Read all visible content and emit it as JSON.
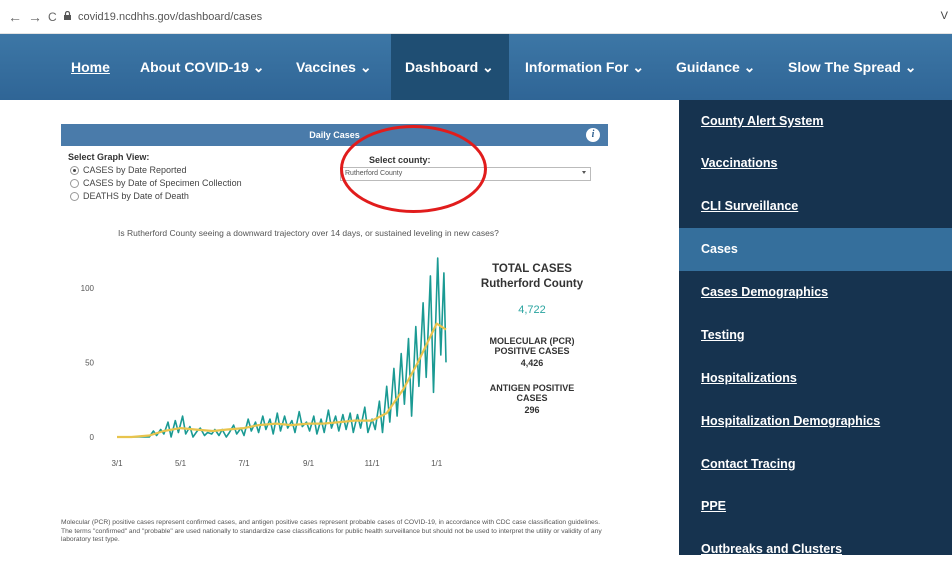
{
  "browser": {
    "back": "←",
    "forward": "→",
    "reload": "C",
    "url": "covid19.ncdhhs.gov/dashboard/cases",
    "edge_char": "V"
  },
  "nav": {
    "home": "Home",
    "about": "About COVID-19 ⌄",
    "vaccines": "Vaccines ⌄",
    "dashboard": "Dashboard ⌄",
    "information": "Information For ⌄",
    "guidance": "Guidance ⌄",
    "slow": "Slow The Spread ⌄"
  },
  "sidebar": {
    "items": [
      {
        "label": "County Alert System",
        "active": false
      },
      {
        "label": "Vaccinations",
        "active": false
      },
      {
        "label": "CLI Surveillance",
        "active": false
      },
      {
        "label": "Cases",
        "active": true
      },
      {
        "label": "Cases Demographics",
        "active": false
      },
      {
        "label": "Testing",
        "active": false
      },
      {
        "label": "Hospitalizations",
        "active": false
      },
      {
        "label": "Hospitalization Demographics",
        "active": false
      },
      {
        "label": "Contact Tracing",
        "active": false
      },
      {
        "label": "PPE",
        "active": false
      },
      {
        "label": "Outbreaks and Clusters",
        "active": false
      }
    ]
  },
  "panel": {
    "title": "Daily Cases",
    "info": "i",
    "graph_view_title": "Select Graph View:",
    "options": [
      {
        "label": "CASES by Date Reported",
        "checked": true
      },
      {
        "label": "CASES by Date of Specimen Collection",
        "checked": false
      },
      {
        "label": "DEATHS by Date of Death",
        "checked": false
      }
    ],
    "county_label": "Select county:",
    "county_value": "Rutherford County",
    "question": "Is Rutherford County seeing a downward trajectory over 14 days, or sustained leveling in new cases?"
  },
  "stats": {
    "total_title": "TOTAL CASES",
    "total_county": "Rutherford County",
    "total_value": "4,722",
    "pcr_title_1": "MOLECULAR (PCR)",
    "pcr_title_2": "POSITIVE CASES",
    "pcr_value": "4,426",
    "ag_title_1": "ANTIGEN POSITIVE",
    "ag_title_2": "CASES",
    "ag_value": "296"
  },
  "footnote": "Molecular (PCR) positive cases represent confirmed cases, and antigen positive cases represent probable cases of COVID-19, in accordance with CDC case classification guidelines. The terms \"confirmed\" and \"probable\" are used nationally to standardize case classifications for public health surveillance but should not be used to interpret the utility or validity of any laboratory test type.",
  "colors": {
    "nav_bg": "#3566a0",
    "nav_active": "#1f4e73",
    "sidebar_bg": "#16334f",
    "sidebar_active": "#356f9c",
    "daily_line": "#1a9a93",
    "avg_line": "#e8c44d",
    "total_value": "#2aa4a0",
    "circle": "#e11c1c"
  },
  "chart_data": {
    "type": "line",
    "title": "",
    "xlabel": "",
    "ylabel": "",
    "x_ticks": [
      "3/1",
      "5/1",
      "7/1",
      "9/1",
      "11/1",
      "1/1"
    ],
    "y_ticks": [
      0,
      50,
      100
    ],
    "ylim": [
      0,
      120
    ],
    "grid": false,
    "series": [
      {
        "x": [
          "3/1",
          "3/15",
          "4/1",
          "4/5",
          "4/8",
          "4/12",
          "4/15",
          "4/19",
          "4/22",
          "4/26",
          "4/29",
          "5/3",
          "5/6",
          "5/10",
          "5/13",
          "5/17",
          "5/20",
          "5/24",
          "5/27",
          "5/31",
          "6/3",
          "6/7",
          "6/10",
          "6/14",
          "6/17",
          "6/21",
          "6/24",
          "6/28",
          "7/1",
          "7/5",
          "7/8",
          "7/12",
          "7/15",
          "7/19",
          "7/22",
          "7/26",
          "7/29",
          "8/2",
          "8/5",
          "8/9",
          "8/12",
          "8/16",
          "8/19",
          "8/23",
          "8/26",
          "8/30",
          "9/2",
          "9/6",
          "9/9",
          "9/13",
          "9/16",
          "9/20",
          "9/23",
          "9/27",
          "9/30",
          "10/4",
          "10/7",
          "10/11",
          "10/14",
          "10/18",
          "10/21",
          "10/25",
          "10/28",
          "11/1",
          "11/4",
          "11/8",
          "11/11",
          "11/15",
          "11/18",
          "11/22",
          "11/25",
          "11/29",
          "12/2",
          "12/6",
          "12/9",
          "12/13",
          "12/16",
          "12/20",
          "12/23",
          "12/27",
          "12/30",
          "1/2",
          "1/5",
          "1/8",
          "1/10"
        ],
        "values": [
          0,
          0,
          0,
          4,
          1,
          5,
          2,
          10,
          0,
          11,
          3,
          14,
          2,
          7,
          0,
          4,
          6,
          1,
          3,
          2,
          5,
          1,
          5,
          0,
          3,
          8,
          2,
          6,
          1,
          12,
          4,
          10,
          3,
          14,
          5,
          12,
          2,
          16,
          4,
          14,
          6,
          11,
          3,
          17,
          7,
          10,
          4,
          14,
          2,
          12,
          3,
          18,
          6,
          14,
          4,
          15,
          5,
          16,
          3,
          15,
          6,
          20,
          3,
          12,
          5,
          24,
          3,
          34,
          10,
          46,
          14,
          56,
          22,
          66,
          14,
          74,
          34,
          90,
          40,
          108,
          30,
          120,
          55,
          110,
          50
        ]
      },
      {
        "x": [
          "3/1",
          "3/15",
          "4/1",
          "4/15",
          "5/1",
          "5/15",
          "6/1",
          "6/15",
          "7/1",
          "7/15",
          "8/1",
          "8/15",
          "9/1",
          "9/15",
          "10/1",
          "10/15",
          "11/1",
          "11/15",
          "12/1",
          "12/15",
          "1/1",
          "1/10"
        ],
        "values": [
          0,
          0,
          1,
          4,
          6,
          5,
          4,
          5,
          6,
          8,
          9,
          8,
          9,
          9,
          10,
          11,
          11,
          16,
          32,
          50,
          76,
          72
        ]
      }
    ]
  }
}
